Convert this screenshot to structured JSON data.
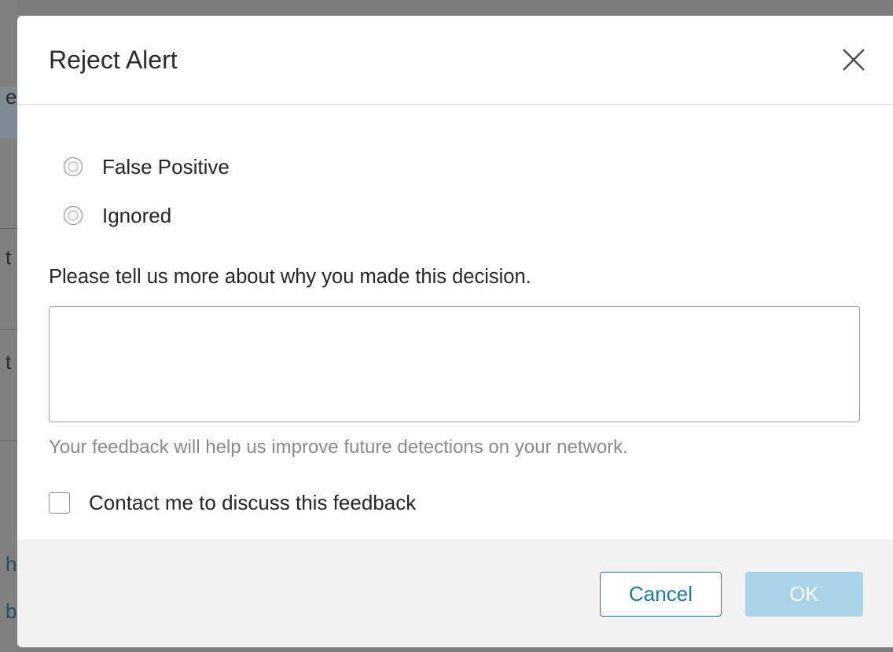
{
  "dialog": {
    "title": "Reject Alert",
    "close_label": "close",
    "options": [
      {
        "label": "False Positive",
        "selected": false
      },
      {
        "label": "Ignored",
        "selected": false
      }
    ],
    "prompt": "Please tell us more about why you made this decision.",
    "feedback_value": "",
    "helper_text": "Your feedback will help us improve future detections on your network.",
    "contact_label": "Contact me to discuss this feedback",
    "contact_checked": false,
    "cancel_label": "Cancel",
    "ok_label": "OK",
    "ok_enabled": false
  },
  "background": {
    "edge_chars": [
      "e",
      "t",
      "t",
      "h",
      "b"
    ]
  },
  "colors": {
    "accent": "#1e7aa8",
    "ok_disabled": "#a9d3e8",
    "footer_bg": "#f2f2f2",
    "overlay": "#7d7d7d"
  },
  "icons": {
    "close": "close-icon",
    "radio": "radio-unselected-icon",
    "checkbox": "checkbox-unchecked-icon"
  }
}
